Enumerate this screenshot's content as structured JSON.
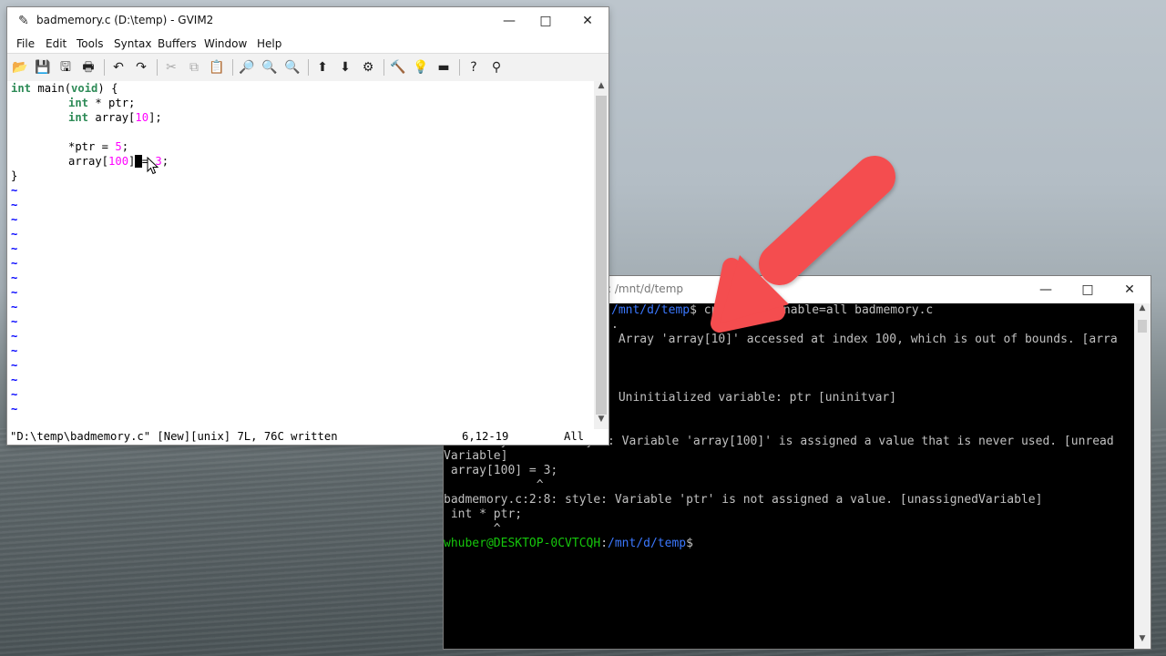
{
  "gvim": {
    "title": "badmemory.c (D:\\temp) - GVIM2",
    "menu": [
      "File",
      "Edit",
      "Tools",
      "Syntax",
      "Buffers",
      "Window",
      "Help"
    ],
    "code": {
      "line1_kw": "int",
      "line1_rest_a": " main(",
      "line1_void": "void",
      "line1_rest_b": ") {",
      "line2_kw": "int",
      "line2_rest": " * ptr;",
      "line3_kw": "int",
      "line3_rest_a": " array[",
      "line3_num": "10",
      "line3_rest_b": "];",
      "line5_a": "*ptr = ",
      "line5_num": "5",
      "line5_b": ";",
      "line6_a": "array[",
      "line6_num": "100",
      "line6_b": "]",
      "line6_cursor": " ",
      "line6_c": "= ",
      "line6_num2": "3",
      "line6_d": ";",
      "line7": "}"
    },
    "tilde": "~",
    "status_message": "\"D:\\temp\\badmemory.c\" [New][unix] 7L, 76C written",
    "position": "6,12-19",
    "scroll_pos": "All"
  },
  "terminal": {
    "title": ": /mnt/d/temp",
    "lines": {
      "l1_path": "/mnt/d/temp",
      "l1_prompt": "$ ",
      "l1_cmd_a": "cpp",
      "l1_cmd_b": "-enable=all badmemory.c",
      "l2": ".",
      "l3": " Array 'array[10]' accessed at index 100, which is out of bounds. [arra",
      "l4": " Uninitialized variable: ptr [uninitvar]",
      "l5": "badmemory.c:6:15: style: Variable 'array[100]' is assigned a value that is never used. [unread",
      "l6": "Variable]",
      "l7": " array[100] = 3;",
      "l8": "             ^",
      "l9": "badmemory.c:2:8: style: Variable 'ptr' is not assigned a value. [unassignedVariable]",
      "l10": " int * ptr;",
      "l11": "       ^",
      "p_user": "whuber@DESKTOP-0CVTCQH",
      "p_colon": ":",
      "p_path": "/mnt/d/temp",
      "p_dollar": "$"
    }
  },
  "colors": {
    "annotation_arrow": "#f44d4f",
    "terminal_prompt_user": "#16c60c",
    "terminal_prompt_path": "#3b78ff",
    "vim_keyword": "#2e8b57",
    "vim_number": "#ff00ff",
    "vim_tilde": "#0000ff"
  }
}
